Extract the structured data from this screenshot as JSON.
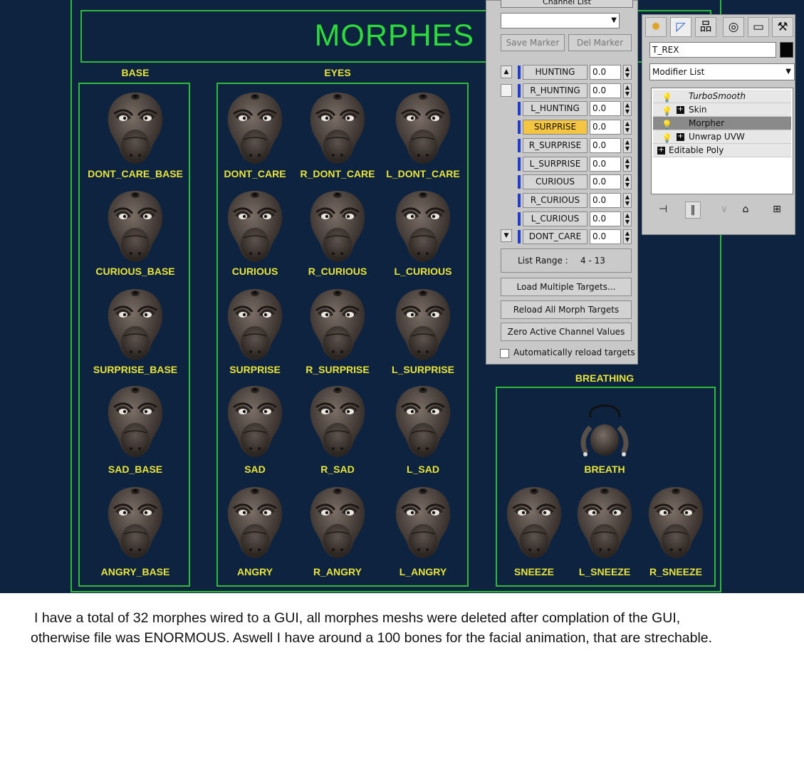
{
  "gui": {
    "title": "MORPHES",
    "sections": {
      "base": "BASE",
      "eyes": "EYES",
      "breathing": "BREATHING"
    },
    "base": [
      "DONT_CARE_BASE",
      "CURIOUS_BASE",
      "SURPRISE_BASE",
      "SAD_BASE",
      "ANGRY_BASE"
    ],
    "eyes": [
      [
        "DONT_CARE",
        "R_DONT_CARE",
        "L_DONT_CARE"
      ],
      [
        "CURIOUS",
        "R_CURIOUS",
        "L_CURIOUS"
      ],
      [
        "SURPRISE",
        "R_SURPRISE",
        "L_SURPRISE"
      ],
      [
        "SAD",
        "R_SAD",
        "L_SAD"
      ],
      [
        "ANGRY",
        "R_ANGRY",
        "L_ANGRY"
      ]
    ],
    "breath": "BREATH",
    "sneeze": [
      "SNEEZE",
      "L_SNEEZE",
      "R_SNEEZE"
    ]
  },
  "channel_list": {
    "title": "Channel List",
    "save_marker": "Save Marker",
    "del_marker": "Del Marker",
    "channels": [
      {
        "name": "HUNTING",
        "value": "0.0"
      },
      {
        "name": "R_HUNTING",
        "value": "0.0"
      },
      {
        "name": "L_HUNTING",
        "value": "0.0"
      },
      {
        "name": "SURPRISE",
        "value": "0.0"
      },
      {
        "name": "R_SURPRISE",
        "value": "0.0"
      },
      {
        "name": "L_SURPRISE",
        "value": "0.0"
      },
      {
        "name": "CURIOUS",
        "value": "0.0"
      },
      {
        "name": "R_CURIOUS",
        "value": "0.0"
      },
      {
        "name": "L_CURIOUS",
        "value": "0.0"
      },
      {
        "name": "DONT_CARE",
        "value": "0.0"
      }
    ],
    "active_channel": "SURPRISE",
    "list_range_label": "List Range :",
    "list_range_value": "4 - 13",
    "load_multiple": "Load Multiple Targets...",
    "reload_all": "Reload All Morph Targets",
    "zero_active": "Zero Active Channel Values",
    "auto_reload": "Automatically reload targets"
  },
  "modify_panel": {
    "tabs": [
      "create-icon",
      "modify-icon",
      "hierarchy-icon",
      "motion-icon",
      "display-icon",
      "utilities-icon"
    ],
    "object_name": "T_REX",
    "object_color": "#050505",
    "modifier_list": "Modifier List",
    "stack": [
      "TurboSmooth",
      "Skin",
      "Morpher",
      "Unwrap UVW",
      "Editable Poly"
    ],
    "selected": "Morpher"
  },
  "colors": {
    "viewport_bg": "#0e2340",
    "gui_green": "#2dbb3a",
    "label_yellow": "#e8e43a",
    "channel_bar": "#1f3ccf",
    "active_channel": "#f4c542"
  },
  "caption": {
    "line1": "I have a total of 32 morphes wired to a GUI, all morphes meshs were deleted after complation of the GUI,",
    "line2": "otherwise file was ENORMOUS. Aswell I have around a 100 bones for the facial animation, that are strechable."
  }
}
